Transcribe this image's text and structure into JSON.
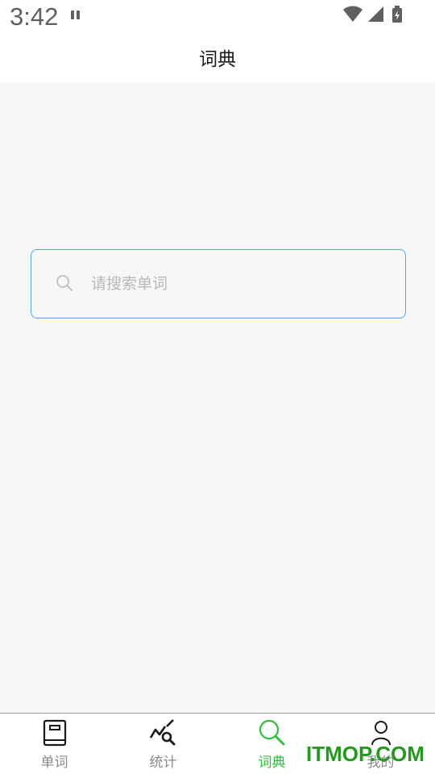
{
  "status_bar": {
    "time": "3:42"
  },
  "app_bar": {
    "title": "词典"
  },
  "search": {
    "placeholder": "请搜索单词",
    "value": ""
  },
  "tabs": [
    {
      "label": "单词",
      "icon": "book-icon",
      "active": false
    },
    {
      "label": "统计",
      "icon": "chart-search-icon",
      "active": false
    },
    {
      "label": "词典",
      "icon": "search-icon",
      "active": true
    },
    {
      "label": "我的",
      "icon": "person-icon",
      "active": false
    }
  ],
  "watermark": "ITMOP.COM",
  "colors": {
    "accent": "#2fbf3a",
    "search_border": "#5aa3e3",
    "inactive_tab": "#8a8a8a",
    "background": "#f7f7f7"
  }
}
